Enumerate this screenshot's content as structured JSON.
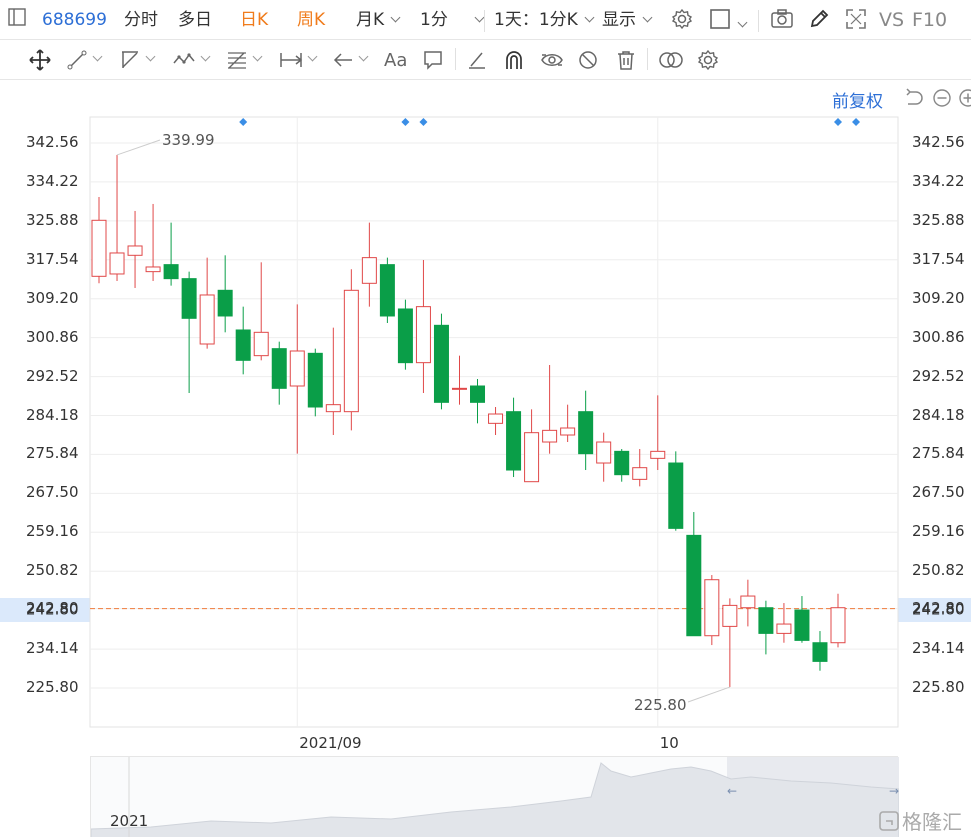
{
  "topbar": {
    "stock_code": "688699",
    "tabs": [
      "分时",
      "多日",
      "日K",
      "周K",
      "月K",
      "1分"
    ],
    "interval_select": "1天：1分K",
    "display_select": "显示",
    "vs_label": "VS",
    "f10_label": "F10"
  },
  "toolbar": {
    "icons": [
      "move-icon",
      "line-icon",
      "ray-icon",
      "wave-icon",
      "fib-icon",
      "measure-icon",
      "arrow-icon",
      "text-icon",
      "comment-icon",
      "pen-icon",
      "magnet-icon",
      "hide-icon",
      "eye-off-icon",
      "trash-icon",
      "compare-icon",
      "settings-icon"
    ],
    "text_tool": "Aa"
  },
  "adjust_label": "前复权",
  "colors": {
    "up": "#e04848",
    "down": "#0a9e48",
    "grid": "#eeeeee",
    "accent": "#2d6fd6",
    "price_line": "#f07c3c",
    "marker": "#3a8ee6"
  },
  "chart_data": {
    "type": "candlestick",
    "y_ticks": [
      "342.56",
      "334.22",
      "325.88",
      "317.54",
      "309.20",
      "300.86",
      "292.52",
      "284.18",
      "275.84",
      "267.50",
      "259.16",
      "250.82",
      "242.80",
      "234.14",
      "225.80"
    ],
    "ylim": [
      225.8,
      342.56
    ],
    "x_labels": [
      {
        "text": "2021/09",
        "index": 11
      },
      {
        "text": "10",
        "index": 31
      }
    ],
    "high_label": "339.99",
    "low_label": "225.80",
    "last_price": "242.80",
    "event_markers": [
      8,
      17,
      18,
      41,
      42
    ],
    "candles": [
      {
        "o": 314.0,
        "h": 331.0,
        "l": 312.5,
        "c": 326.0
      },
      {
        "o": 314.5,
        "h": 340.0,
        "l": 313.0,
        "c": 319.0
      },
      {
        "o": 318.5,
        "h": 328.0,
        "l": 311.5,
        "c": 320.5
      },
      {
        "o": 315.0,
        "h": 329.5,
        "l": 313.0,
        "c": 316.0
      },
      {
        "o": 316.5,
        "h": 325.5,
        "l": 312.0,
        "c": 313.5
      },
      {
        "o": 313.5,
        "h": 315.0,
        "l": 289.0,
        "c": 305.0
      },
      {
        "o": 299.5,
        "h": 318.0,
        "l": 298.5,
        "c": 310.0
      },
      {
        "o": 311.0,
        "h": 318.5,
        "l": 302.0,
        "c": 305.5
      },
      {
        "o": 302.5,
        "h": 307.5,
        "l": 293.0,
        "c": 296.0
      },
      {
        "o": 297.0,
        "h": 317.0,
        "l": 296.0,
        "c": 302.0
      },
      {
        "o": 298.5,
        "h": 300.0,
        "l": 286.5,
        "c": 290.0
      },
      {
        "o": 290.5,
        "h": 308.0,
        "l": 276.0,
        "c": 298.0
      },
      {
        "o": 297.5,
        "h": 298.5,
        "l": 284.0,
        "c": 286.0
      },
      {
        "o": 285.0,
        "h": 303.0,
        "l": 280.0,
        "c": 286.5
      },
      {
        "o": 285.0,
        "h": 315.5,
        "l": 281.0,
        "c": 311.0
      },
      {
        "o": 312.5,
        "h": 325.5,
        "l": 307.5,
        "c": 318.0
      },
      {
        "o": 316.5,
        "h": 318.0,
        "l": 304.0,
        "c": 305.5
      },
      {
        "o": 307.0,
        "h": 309.0,
        "l": 294.0,
        "c": 295.5
      },
      {
        "o": 295.5,
        "h": 317.5,
        "l": 289.0,
        "c": 307.5
      },
      {
        "o": 303.5,
        "h": 306.0,
        "l": 285.5,
        "c": 287.0
      },
      {
        "o": 290.0,
        "h": 297.0,
        "l": 286.5,
        "c": 290.0
      },
      {
        "o": 290.5,
        "h": 292.0,
        "l": 282.5,
        "c": 287.0
      },
      {
        "o": 282.5,
        "h": 286.0,
        "l": 280.0,
        "c": 284.5
      },
      {
        "o": 285.0,
        "h": 288.0,
        "l": 271.0,
        "c": 272.5
      },
      {
        "o": 270.0,
        "h": 285.5,
        "l": 270.0,
        "c": 280.5
      },
      {
        "o": 278.5,
        "h": 295.0,
        "l": 276.0,
        "c": 281.0
      },
      {
        "o": 280.0,
        "h": 286.5,
        "l": 278.5,
        "c": 281.5
      },
      {
        "o": 285.0,
        "h": 289.5,
        "l": 272.5,
        "c": 276.0
      },
      {
        "o": 274.0,
        "h": 280.5,
        "l": 270.0,
        "c": 278.5
      },
      {
        "o": 276.5,
        "h": 277.0,
        "l": 270.0,
        "c": 271.5
      },
      {
        "o": 270.5,
        "h": 277.0,
        "l": 269.0,
        "c": 273.0
      },
      {
        "o": 275.0,
        "h": 288.5,
        "l": 272.5,
        "c": 276.5
      },
      {
        "o": 274.0,
        "h": 276.5,
        "l": 259.5,
        "c": 260.0
      },
      {
        "o": 258.5,
        "h": 263.5,
        "l": 237.5,
        "c": 237.0
      },
      {
        "o": 237.0,
        "h": 250.0,
        "l": 235.0,
        "c": 249.0
      },
      {
        "o": 239.0,
        "h": 245.0,
        "l": 226.0,
        "c": 243.5
      },
      {
        "o": 243.0,
        "h": 249.0,
        "l": 239.0,
        "c": 245.5
      },
      {
        "o": 243.0,
        "h": 244.5,
        "l": 233.0,
        "c": 237.5
      },
      {
        "o": 237.5,
        "h": 244.0,
        "l": 235.5,
        "c": 239.5
      },
      {
        "o": 242.5,
        "h": 245.5,
        "l": 235.5,
        "c": 236.0
      },
      {
        "o": 235.5,
        "h": 238.0,
        "l": 229.5,
        "c": 231.5
      },
      {
        "o": 235.5,
        "h": 246.0,
        "l": 234.5,
        "c": 243.0
      }
    ]
  },
  "navigator": {
    "year_label": "2021"
  },
  "watermark": "格隆汇"
}
